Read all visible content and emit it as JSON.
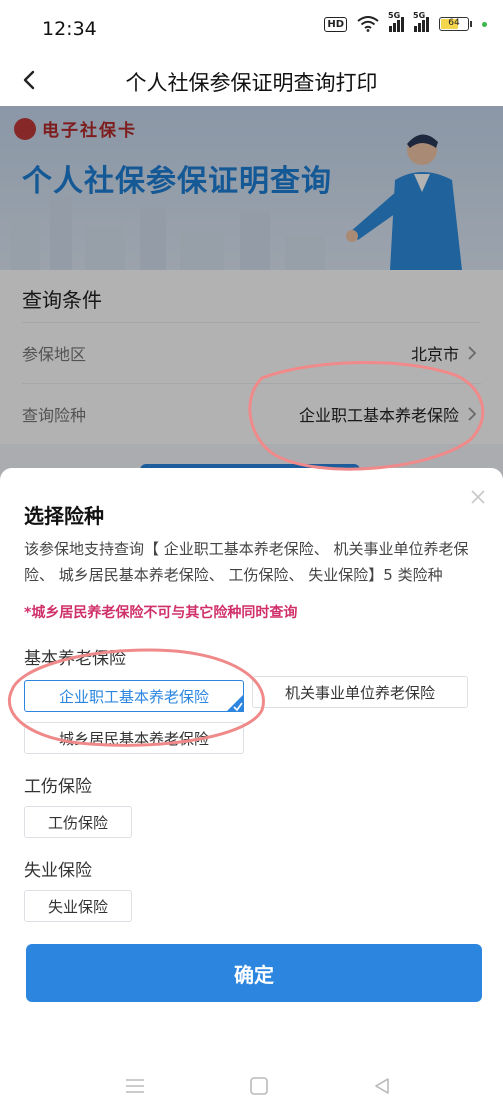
{
  "status_bar": {
    "time": "12:34",
    "hd_label": "HD",
    "sim1_label": "5G",
    "sim2_label": "5G",
    "battery_percent": 64,
    "battery_label": "64"
  },
  "nav": {
    "title": "个人社保参保证明查询打印",
    "back_icon": "chevron-left-icon"
  },
  "banner": {
    "logo_text": "电子社保卡",
    "title": "个人社保参保证明查询"
  },
  "query": {
    "heading": "查询条件",
    "rows": [
      {
        "label": "参保地区",
        "value": "北京市"
      },
      {
        "label": "查询险种",
        "value": "企业职工基本养老保险"
      }
    ]
  },
  "sheet": {
    "title": "选择险种",
    "description": "该参保地支持查询【 企业职工基本养老保险、 机关事业单位养老保险、 城乡居民基本养老保险、 工伤保险、 失业保险】5 类险种",
    "warning": "*城乡居民养老保险不可与其它险种同时查询",
    "groups": [
      {
        "title": "基本养老保险",
        "options": [
          {
            "label": "企业职工基本养老保险",
            "selected": true
          },
          {
            "label": "机关事业单位养老保险",
            "selected": false
          },
          {
            "label": "城乡居民基本养老保险",
            "selected": false
          }
        ]
      },
      {
        "title": "工伤保险",
        "options": [
          {
            "label": "工伤保险",
            "selected": false
          }
        ]
      },
      {
        "title": "失业保险",
        "options": [
          {
            "label": "失业保险",
            "selected": false
          }
        ]
      }
    ],
    "confirm_label": "确定"
  },
  "system_nav": {
    "icons": [
      "menu-icon",
      "home-square-icon",
      "back-triangle-icon"
    ]
  },
  "colors": {
    "accent_blue": "#2c86e0",
    "warning_pink": "#d0306a",
    "annotation_red": "#f08a8a"
  }
}
